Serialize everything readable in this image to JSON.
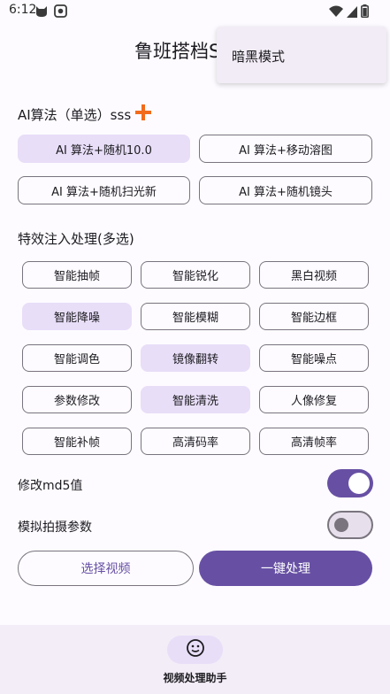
{
  "status_bar": {
    "time": "6:12",
    "icons": [
      "cat-icon",
      "badge-icon",
      "wifi-icon",
      "signal-icon",
      "battery-icon"
    ]
  },
  "app": {
    "title": "鲁班搭档S"
  },
  "menu": {
    "items": [
      "暗黑模式"
    ]
  },
  "ai_section": {
    "title": "AI算法（单选）sss",
    "options": [
      {
        "label": "AI 算法+随机10.0",
        "selected": true
      },
      {
        "label": "AI 算法+移动溶图",
        "selected": false
      },
      {
        "label": "AI 算法+随机扫光新",
        "selected": false
      },
      {
        "label": "AI 算法+随机镜头",
        "selected": false
      }
    ]
  },
  "effects_section": {
    "title": "特效注入处理(多选)",
    "options": [
      {
        "label": "智能抽帧",
        "selected": false
      },
      {
        "label": "智能锐化",
        "selected": false
      },
      {
        "label": "黑白视频",
        "selected": false
      },
      {
        "label": "智能降噪",
        "selected": true
      },
      {
        "label": "智能模糊",
        "selected": false
      },
      {
        "label": "智能边框",
        "selected": false
      },
      {
        "label": "智能调色",
        "selected": false
      },
      {
        "label": "镜像翻转",
        "selected": true
      },
      {
        "label": "智能噪点",
        "selected": false
      },
      {
        "label": "参数修改",
        "selected": false
      },
      {
        "label": "智能清洗",
        "selected": true
      },
      {
        "label": "人像修复",
        "selected": false
      },
      {
        "label": "智能补帧",
        "selected": false
      },
      {
        "label": "高清码率",
        "selected": false
      },
      {
        "label": "高清帧率",
        "selected": false
      }
    ]
  },
  "toggles": [
    {
      "label": "修改md5值",
      "on": true
    },
    {
      "label": "模拟拍摄参数",
      "on": false
    }
  ],
  "actions": {
    "select_video": "选择视频",
    "process": "一键处理"
  },
  "bottom_nav": {
    "label": "视频处理助手",
    "icon": "smiley-icon"
  },
  "colors": {
    "primary": "#6750a4",
    "selected_chip": "#e8def8",
    "accent_plus": "#f26b1d",
    "nav_bg": "#f3edf7"
  }
}
